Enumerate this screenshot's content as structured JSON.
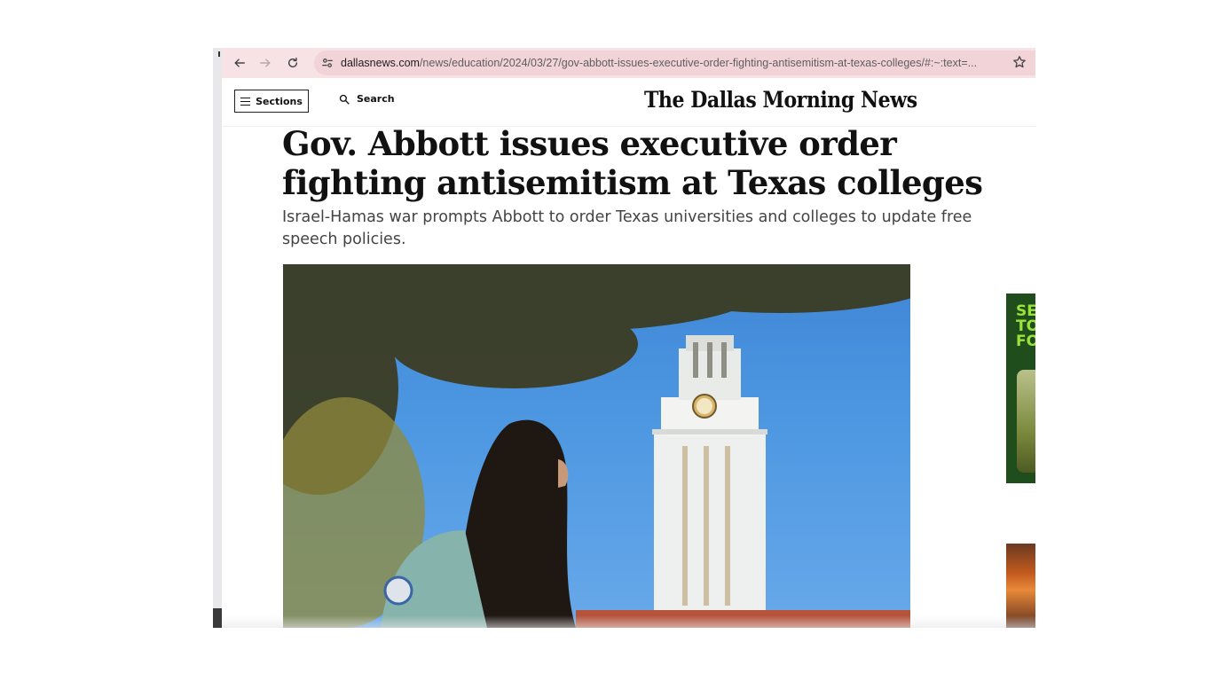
{
  "browser": {
    "url_host": "dallasnews.com",
    "url_path": "/news/education/2024/03/27/gov-abbott-issues-executive-order-fighting-antisemitism-at-texas-colleges/#:~:text=...",
    "toolbar_color": "#f7e3e6"
  },
  "header": {
    "sections_label": "Sections",
    "search_label": "Search",
    "logo_text": "The Dallas Morning News"
  },
  "article": {
    "headline": "Gov. Abbott issues executive order fighting antisemitism at Texas colleges",
    "dek": "Israel-Hamas war prompts Abbott to order Texas universities and colleges to update free speech policies."
  },
  "ad": {
    "text": "SE\nTO\nFO",
    "text_color": "#9be33b",
    "background": "#1f4d1c"
  },
  "icons": {
    "back": "arrow-left-icon",
    "forward": "arrow-right-icon",
    "reload": "reload-icon",
    "site_info": "tune-icon",
    "bookmark": "star-icon",
    "menu": "hamburger-icon",
    "search": "search-icon"
  }
}
